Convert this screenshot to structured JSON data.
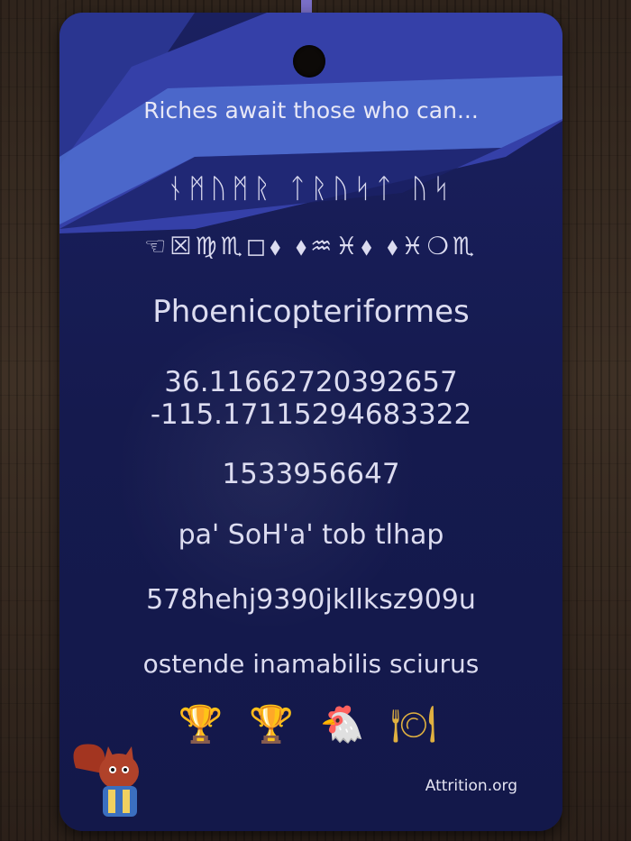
{
  "card": {
    "teaser": "Riches await those who can...",
    "runes": "ᚾᛗᚢᛗᚱ ᛏᚱᚢᛋᛏ ᚢᛋ",
    "glyphs": "☜☒♍♏◻⬧ ⬧♒♓⬧ ⬧♓❍♏",
    "order": "Phoenicopteriformes",
    "latitude": "36.11662720392657",
    "longitude": "-115.17115294683322",
    "epoch": "1533956647",
    "klingon": "pa' SoH'a' tob tlhap",
    "code": "578hehj9390jkllksz909u",
    "latin": "ostende inamabilis sciurus",
    "emoji": [
      "🏆",
      "🏆",
      "🐔",
      "🍽"
    ],
    "footer": "Attrition.org"
  }
}
